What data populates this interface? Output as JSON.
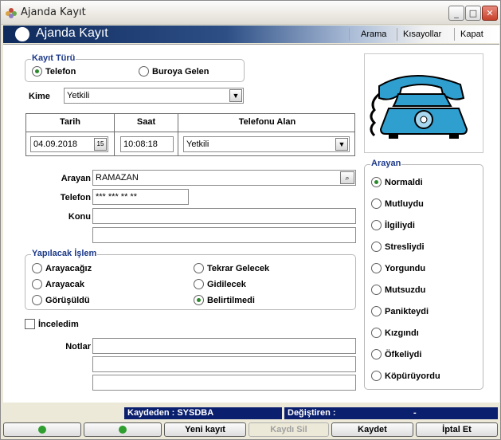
{
  "window": {
    "title": "Ajanda Kayıt",
    "minimize": "_",
    "maximize": "□",
    "close": "✕"
  },
  "header": {
    "title": "Ajanda Kayıt",
    "menu": [
      "Arama",
      "Kısayollar",
      "Kapat"
    ]
  },
  "kayit_turu": {
    "legend": "Kayıt Türü",
    "options": [
      "Telefon",
      "Buroya Gelen"
    ],
    "selected": "Telefon"
  },
  "kime": {
    "label": "Kime",
    "value": "Yetkili"
  },
  "table": {
    "headers": {
      "tarih": "Tarih",
      "saat": "Saat",
      "telefonu_alan": "Telefonu Alan"
    },
    "tarih": "04.09.2018",
    "saat": "10:08:18",
    "telefonu_alan": "Yetkili"
  },
  "form": {
    "arayan_label": "Arayan",
    "arayan_value": "RAMAZAN",
    "telefon_label": "Telefon",
    "telefon_value": "*** *** ** **",
    "konu_label": "Konu"
  },
  "yapilacak": {
    "legend": "Yapılacak İşlem",
    "options": [
      "Arayacağız",
      "Arayacak",
      "Görüşüldü",
      "Tekrar Gelecek",
      "Gidilecek",
      "Belirtilmedi"
    ],
    "selected": "Belirtilmedi"
  },
  "inceledim": {
    "label": "İnceledim",
    "checked": false
  },
  "notlar": {
    "label": "Notlar"
  },
  "arayan_mood": {
    "legend": "Arayan",
    "options": [
      "Normaldi",
      "Mutluydu",
      "İlgiliydi",
      "Stresliydi",
      "Yorgundu",
      "Mutsuzdu",
      "Panikteydi",
      "Kızgındı",
      "Öfkeliydi",
      "Köpürüyordu"
    ],
    "selected": "Normaldi"
  },
  "status": {
    "kaydeden": "Kaydeden : SYSDBA",
    "degistiren": "Değiştiren :",
    "degistiren_value": "-"
  },
  "buttons": {
    "prev_icon": "prev-icon",
    "next_icon": "next-icon",
    "yeni": "Yeni kayıt",
    "sil": "Kaydı Sil",
    "kaydet": "Kaydet",
    "iptal": "İptal Et"
  },
  "colors": {
    "accent": "#0a1f6e",
    "radio_dot": "#2a8a2a",
    "phone": "#2f9fd0"
  }
}
